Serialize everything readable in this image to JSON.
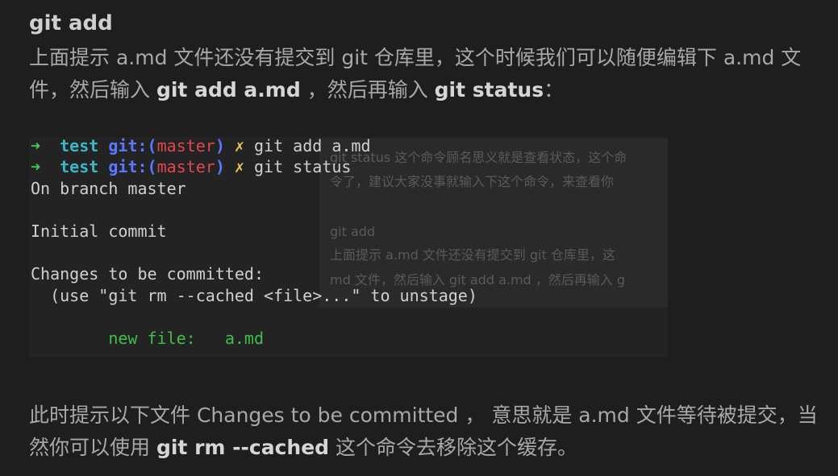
{
  "heading": "git add",
  "para1": {
    "t1": "上面提示 a.md 文件还没有提交到 git 仓库里，这个时候我们可以随便编辑下 a.md 文件，然后输入 ",
    "b1": "git add a.md",
    "t2": " ，然后再输入 ",
    "b2": "git status",
    "t3": "："
  },
  "terminal": {
    "prompt_arrow": "➜",
    "prompt_dir": "test",
    "prompt_git": "git:",
    "prompt_paren_open": "(",
    "prompt_branch": "master",
    "prompt_paren_close": ")",
    "prompt_dirty": "✗",
    "cmd1": "git add a.md",
    "cmd2": "git status",
    "out_branch": "On branch master",
    "out_initial": "Initial commit",
    "out_changes": "Changes to be committed:",
    "out_hint": "  (use \"git rm --cached <file>...\" to unstage)",
    "newfile_label": "        new file:   ",
    "newfile_name": "a.md",
    "ghost_lines": [
      "git status 这个命令顾名思义就是查看状态，这个命",
      "令了，建议大家没事就输入下这个命令，来查看你",
      "git add",
      "上面提示 a.md 文件还没有提交到 git 仓库里，这",
      "md 文件，然后输入 git add a.md ，然后再输入 g"
    ]
  },
  "para2": {
    "t1": "此时提示以下文件 Changes to be committed ， 意思就是 a.md 文件等待被提交，当然你可以使用 ",
    "b1": "git rm --cached",
    "t2": " 这个命令去移除这个缓存。"
  },
  "colors": {
    "background": "#1e1e1e",
    "terminal_bg": "#232323",
    "prompt_arrow": "#3fd05a",
    "prompt_dir": "#37b8c8",
    "prompt_git": "#5a78ff",
    "branch": "#e0464e",
    "new_file": "#3fbf4a"
  }
}
